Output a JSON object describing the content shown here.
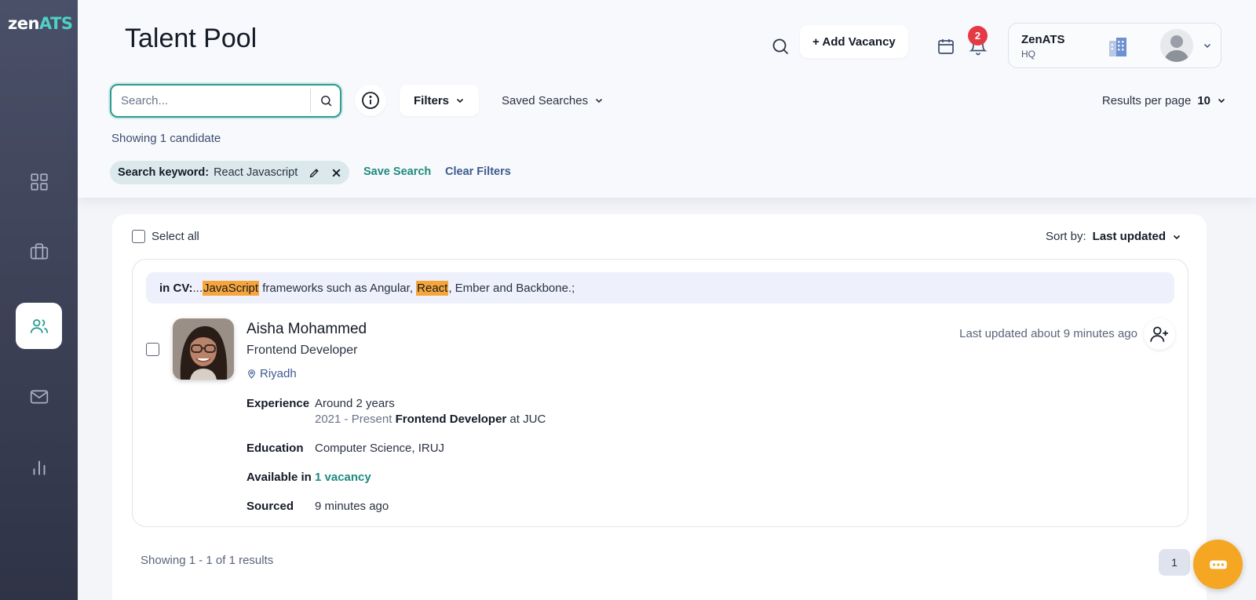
{
  "app": {
    "logo_part1": "zen",
    "logo_part2": "ATS",
    "title": "Talent Pool"
  },
  "sidebar": {
    "items": [
      {
        "name": "dashboard",
        "icon": "grid-icon",
        "active": false
      },
      {
        "name": "vacancies",
        "icon": "briefcase-icon",
        "active": false
      },
      {
        "name": "talent-pool",
        "icon": "users-icon",
        "active": true
      },
      {
        "name": "messages",
        "icon": "mail-icon",
        "active": false
      },
      {
        "name": "reports",
        "icon": "bar-chart-icon",
        "active": false
      }
    ]
  },
  "header": {
    "add_vacancy_label": "+ Add Vacancy",
    "notification_count": "2",
    "org_name": "ZenATS",
    "org_sub": "HQ"
  },
  "search": {
    "placeholder": "Search...",
    "value": ""
  },
  "toolbar": {
    "filters_label": "Filters",
    "saved_searches_label": "Saved Searches",
    "results_per_page_label": "Results per page",
    "results_per_page_value": "10"
  },
  "summary": {
    "showing_text": "Showing 1 candidate"
  },
  "chip": {
    "label": "Search keyword:",
    "value": "React Javascript",
    "save_search": "Save Search",
    "clear_filters": "Clear Filters"
  },
  "list": {
    "select_all_label": "Select all",
    "sort_by_label": "Sort by:",
    "sort_by_value": "Last updated"
  },
  "candidate": {
    "cv_prefix": "in CV:",
    "cv_ellipsis": "...",
    "cv_hl1": "JavaScript",
    "cv_mid": " frameworks such as Angular, ",
    "cv_hl2": "React",
    "cv_end": ", Ember and Backbone.;",
    "name": "Aisha Mohammed",
    "role": "Frontend Developer",
    "location": "Riyadh",
    "last_updated": "Last updated about 9 minutes ago",
    "experience_label": "Experience",
    "experience_value": "Around 2 years",
    "experience_range": "2021 - Present",
    "experience_role": "Frontend Developer",
    "experience_at": " at JUC",
    "education_label": "Education",
    "education_value": "Computer Science, IRUJ",
    "available_label": "Available in",
    "available_value": "1 vacancy",
    "sourced_label": "Sourced",
    "sourced_value": "9 minutes ago"
  },
  "footer": {
    "showing_results": "Showing 1 - 1 of 1 results",
    "page": "1"
  },
  "colors": {
    "accent": "#2a9d8f",
    "highlight": "#f6a53a",
    "fab": "#f5a623",
    "badge": "#e53946"
  }
}
